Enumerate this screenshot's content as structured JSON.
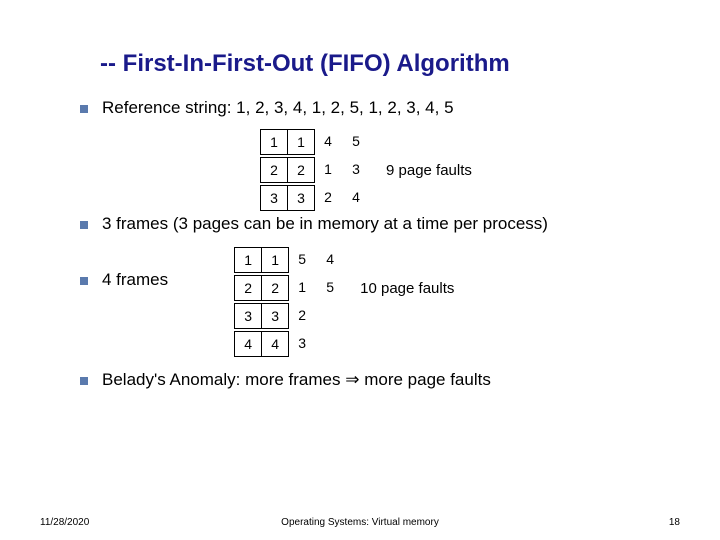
{
  "title": "-- First-In-First-Out (FIFO) Algorithm",
  "bullets": {
    "ref": "Reference string: 1, 2, 3, 4, 1, 2, 5, 1, 2, 3, 4, 5",
    "three_frames": "3 frames (3 pages can be in memory at a time per process)",
    "four_frames": "4 frames",
    "belady_a": "Belady's Anomaly: more frames ",
    "belady_b": " more page faults"
  },
  "table3": {
    "r0": {
      "c0": "1",
      "c1": "1",
      "c2": "4",
      "c3": "5"
    },
    "r1": {
      "c0": "2",
      "c1": "2",
      "c2": "1",
      "c3": "3",
      "label": "9 page faults"
    },
    "r2": {
      "c0": "3",
      "c1": "3",
      "c2": "2",
      "c3": "4"
    }
  },
  "table4": {
    "r0": {
      "c0": "1",
      "c1": "1",
      "c2": "5",
      "c3": "4"
    },
    "r1": {
      "c0": "2",
      "c1": "2",
      "c2": "1",
      "c3": "5",
      "label": "10 page faults"
    },
    "r2": {
      "c0": "3",
      "c1": "3",
      "c2": "2"
    },
    "r3": {
      "c0": "4",
      "c1": "4",
      "c2": "3"
    }
  },
  "footer": {
    "date": "11/28/2020",
    "center": "Operating Systems: Virtual memory",
    "page": "18"
  }
}
